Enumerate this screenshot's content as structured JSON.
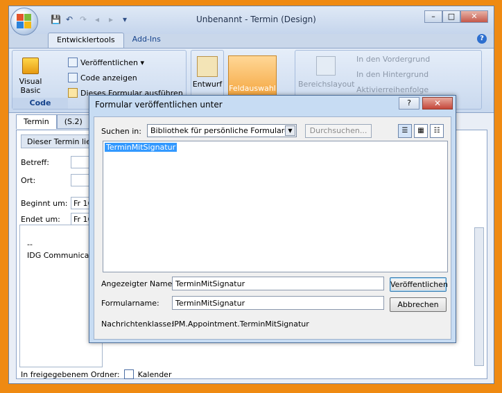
{
  "window": {
    "title": "Unbenannt - Termin  (Design)",
    "controls": {
      "minimize": "–",
      "maximize": "□",
      "close": "✕"
    }
  },
  "qat": [
    "save-icon",
    "undo-icon",
    "redo-icon",
    "previous-icon",
    "next-icon",
    "customize-icon"
  ],
  "ribbon_tabs": [
    {
      "label": "Entwicklertools",
      "active": true
    },
    {
      "label": "Add-Ins",
      "active": false
    }
  ],
  "ribbon": {
    "code_group": {
      "visual_basic": "Visual Basic",
      "items": [
        "Veröffentlichen ▾",
        "Code anzeigen",
        "Dieses Formular ausführen"
      ],
      "label": "Code"
    },
    "design": {
      "label": "Entwurf"
    },
    "field_choice": {
      "label": "Feldauswahl"
    },
    "layout": {
      "big_label": "Bereichslayout",
      "items": [
        "In den Vordergrund",
        "In den Hintergrund",
        "Aktivierreihenfolge"
      ]
    }
  },
  "form": {
    "tabs": [
      {
        "label": "Termin",
        "active": true
      },
      {
        "label": "(S.2)",
        "active": false
      }
    ],
    "info_bar": "Dieser Termin lieg",
    "labels": {
      "betreff": "Betreff:",
      "ort": "Ort:",
      "beginnt": "Beginnt um:",
      "endet": "Endet um:"
    },
    "fields": {
      "beginnt": "Fr 16",
      "endet": "Fr 16"
    },
    "notes": [
      "--",
      "IDG Communica"
    ],
    "shared_folder": {
      "label": "In freigegebenem Ordner:",
      "value": "Kalender"
    }
  },
  "dialog": {
    "title": "Formular veröffentlichen unter",
    "help": "?",
    "close": "✕",
    "search_in_label": "Suchen in:",
    "search_in_value": "Bibliothek für persönliche Formulare",
    "browse_button": "Durchsuchen...",
    "list_items": [
      "TerminMitSignatur"
    ],
    "display_name_label": "Angezeigter Name:",
    "display_name_value": "TerminMitSignatur",
    "form_name_label": "Formularname:",
    "form_name_value": "TerminMitSignatur",
    "message_class_label": "Nachrichtenklasse:",
    "message_class_value": "IPM.Appointment.TerminMitSignatur",
    "publish_button": "Veröffentlichen",
    "cancel_button": "Abbrechen"
  }
}
